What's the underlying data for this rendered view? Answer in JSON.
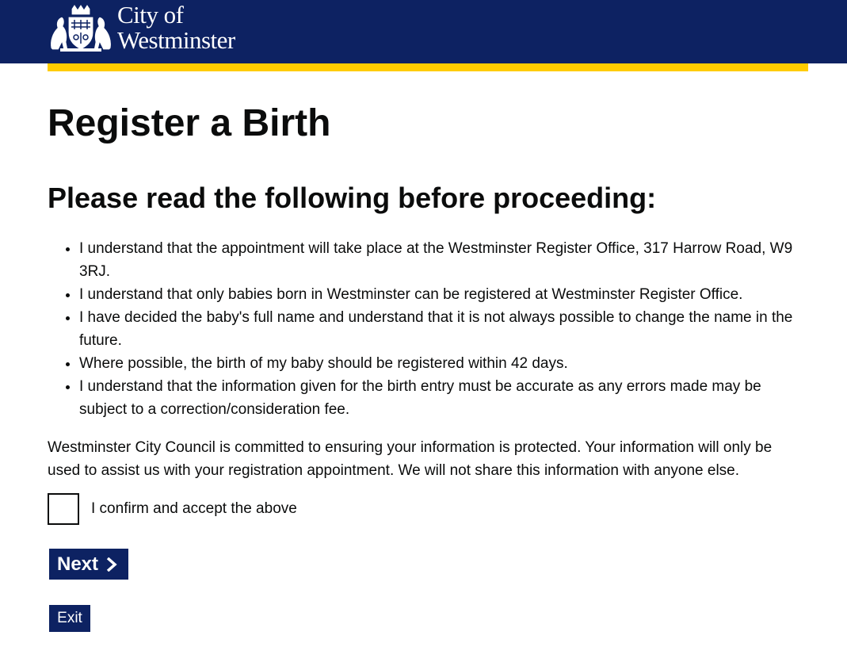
{
  "header": {
    "logo_line1": "City of",
    "logo_line2": "Westminster",
    "background_color": "#0d2262",
    "accent_color": "#ffcc00",
    "crest_icon": "westminster-crest-icon"
  },
  "main": {
    "page_title": "Register a Birth",
    "section_title": "Please read the following before proceeding:",
    "conditions": [
      "I understand that the appointment will take place at the Westminster Register Office, 317 Harrow Road, W9 3RJ.",
      "I understand that only babies born in Westminster can be registered at Westminster Register Office.",
      "I have decided the baby's full name and understand that it is not always possible to change the name in the future.",
      "Where possible, the birth of my baby should be registered within 42 days.",
      "I understand that the information given for the birth entry must be accurate as any errors made may be subject to a correction/consideration fee."
    ],
    "privacy_notice": "Westminster City Council is committed to ensuring your information is protected. Your information will only be used to assist us with your registration appointment. We will not share this information with anyone else.",
    "confirm_label": "I confirm and accept the above",
    "confirm_checked": false
  },
  "actions": {
    "next_label": "Next",
    "next_icon": "chevron-right-icon",
    "exit_label": "Exit"
  }
}
